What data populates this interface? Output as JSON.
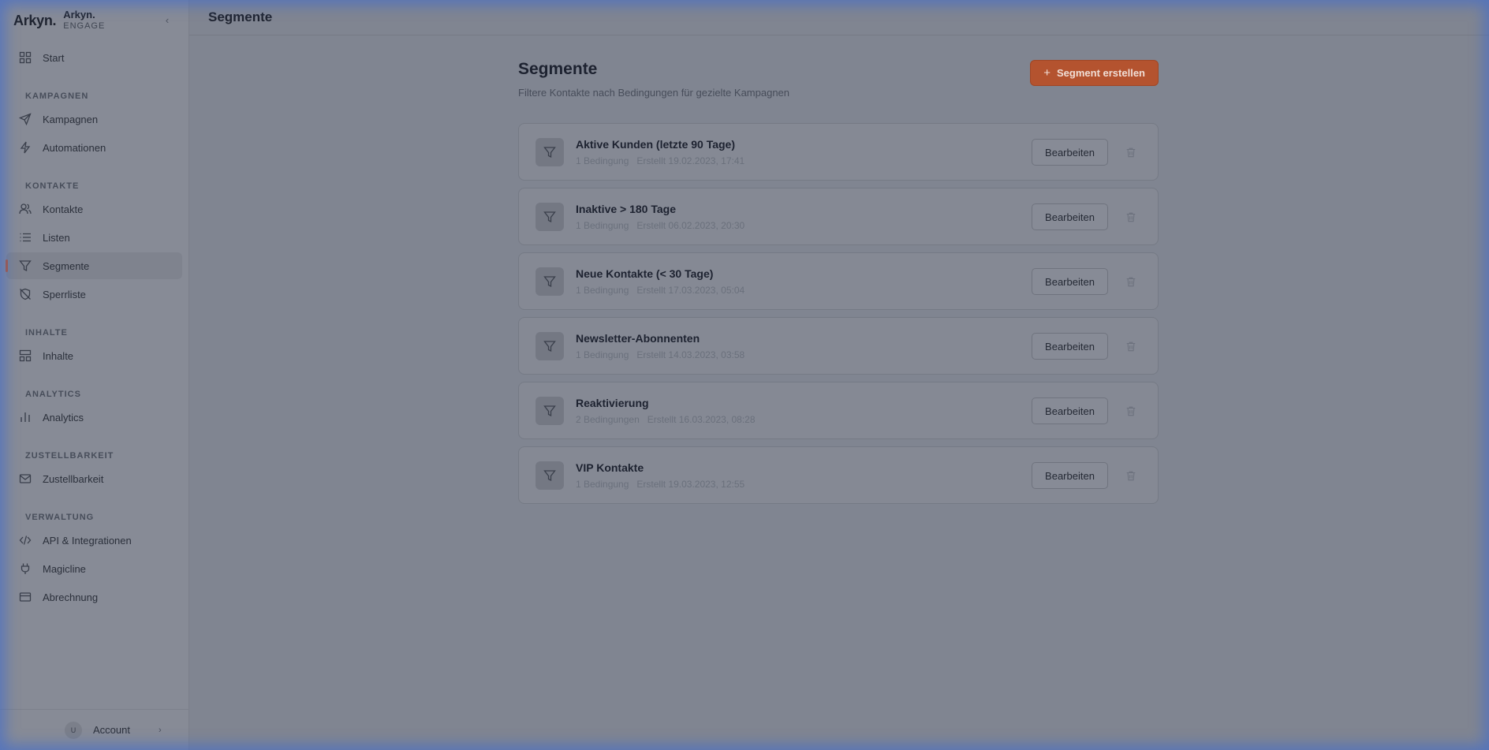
{
  "brand": {
    "logo": "Arkyn.",
    "name": "Arkyn.",
    "sub": "ENGAGE"
  },
  "sidebar": {
    "start": "Start",
    "sections": {
      "kampagnen": "KAMPAGNEN",
      "kontakte": "KONTAKTE",
      "inhalte": "INHALTE",
      "analytics": "ANALYTICS",
      "zustellbarkeit": "ZUSTELLBARKEIT",
      "verwaltung": "VERWALTUNG"
    },
    "items": {
      "kampagnen": "Kampagnen",
      "automationen": "Automationen",
      "kontakte": "Kontakte",
      "listen": "Listen",
      "segmente": "Segmente",
      "sperrliste": "Sperrliste",
      "inhalte": "Inhalte",
      "analytics": "Analytics",
      "zustellbarkeit": "Zustellbarkeit",
      "api": "API & Integrationen",
      "magicline": "Magicline",
      "abrechnung": "Abrechnung"
    },
    "account": {
      "avatar": "U",
      "label": "Account"
    }
  },
  "topbar": {
    "title": "Segmente"
  },
  "page": {
    "title": "Segmente",
    "subtitle": "Filtere Kontakte nach Bedingungen für gezielte Kampagnen",
    "create_label": "Segment erstellen"
  },
  "edit_label": "Bearbeiten",
  "segments": [
    {
      "name": "Aktive Kunden (letzte 90 Tage)",
      "conditions": "1 Bedingung",
      "created": "Erstellt 19.02.2023, 17:41"
    },
    {
      "name": "Inaktive > 180 Tage",
      "conditions": "1 Bedingung",
      "created": "Erstellt 06.02.2023, 20:30"
    },
    {
      "name": "Neue Kontakte (< 30 Tage)",
      "conditions": "1 Bedingung",
      "created": "Erstellt 17.03.2023, 05:04"
    },
    {
      "name": "Newsletter-Abonnenten",
      "conditions": "1 Bedingung",
      "created": "Erstellt 14.03.2023, 03:58"
    },
    {
      "name": "Reaktivierung",
      "conditions": "2 Bedingungen",
      "created": "Erstellt 16.03.2023, 08:28"
    },
    {
      "name": "VIP Kontakte",
      "conditions": "1 Bedingung",
      "created": "Erstellt 19.03.2023, 12:55"
    }
  ],
  "colors": {
    "accent": "#b4532f",
    "overlay": "#808591"
  }
}
